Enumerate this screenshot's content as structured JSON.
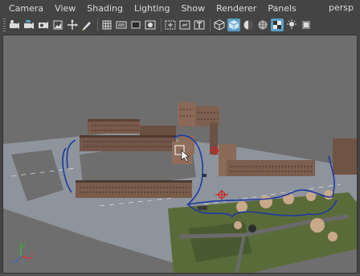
{
  "menu": {
    "camera": "Camera",
    "view": "View",
    "shading": "Shading",
    "lighting": "Lighting",
    "show": "Show",
    "renderer": "Renderer",
    "panels": "Panels"
  },
  "camera_name": "persp",
  "toolbar": {
    "icons": [
      "select-camera-icon",
      "camera-attributes-icon",
      "bookmark-icon",
      "image-plane-icon",
      "two-d-pan-icon",
      "grease-pencil-icon",
      "grid-icon",
      "film-gate-icon",
      "resolution-gate-icon",
      "gate-mask-icon",
      "field-chart-icon",
      "safe-action-icon",
      "safe-title-icon",
      "wireframe-icon",
      "smooth-shade-icon",
      "default-lighting-icon",
      "textured-icon",
      "use-lights-icon",
      "shadows-icon"
    ],
    "active_icons": [
      "smooth-shade-icon",
      "textured-icon"
    ]
  },
  "axis": {
    "x": "x",
    "y": "y",
    "z": "z"
  },
  "colors": {
    "accent": "#5b9fc7",
    "viewport_bg": "#6e6e6e",
    "road": "#8e949c",
    "grass": "#5a6b3a",
    "curve": "#1c3aa0"
  }
}
